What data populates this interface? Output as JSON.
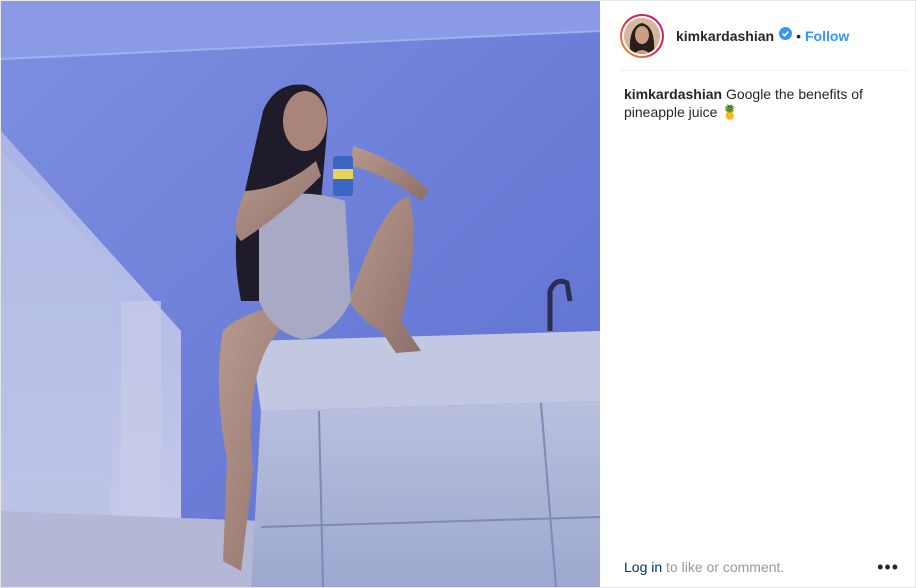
{
  "post": {
    "username": "kimkardashian",
    "verified": true,
    "separator": "•",
    "follow_label": "Follow",
    "caption": {
      "username": "kimkardashian",
      "text": "Google the benefits of pineapple juice",
      "emoji": "🍍"
    },
    "footer": {
      "login_label": "Log in",
      "login_rest": "to like or comment.",
      "more_label": "•••"
    },
    "photo_icon": "photo-image",
    "colors": {
      "follow": "#3897f0",
      "verified_badge": "#3897f0",
      "login_link": "#003569",
      "muted_text": "#999999"
    }
  }
}
